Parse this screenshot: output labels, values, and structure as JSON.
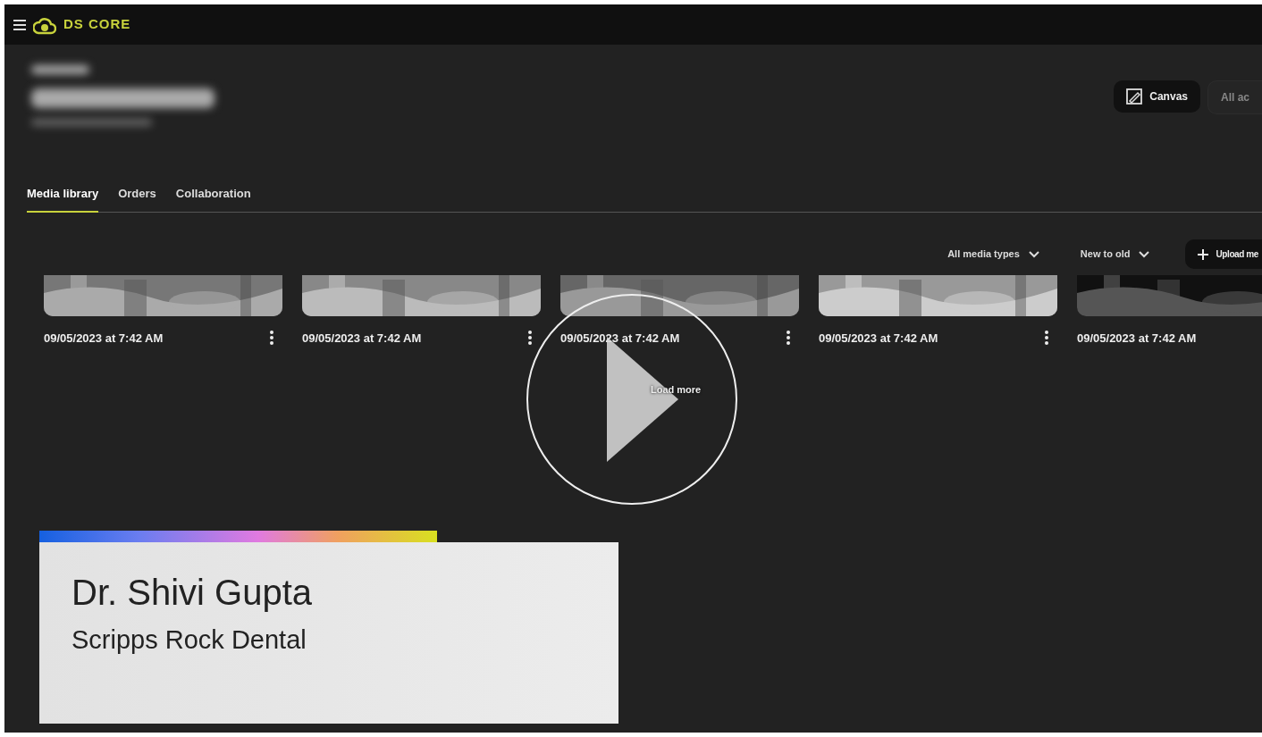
{
  "top_bar": {
    "brand": "DS CORE"
  },
  "header": {
    "buttons": [
      {
        "label": "Canvas",
        "kind": "canvas"
      },
      {
        "label": "All ac",
        "kind": "plain"
      }
    ]
  },
  "tabs": [
    {
      "label": "Media library",
      "selected": true
    },
    {
      "label": "Orders",
      "selected": false
    },
    {
      "label": "Collaboration",
      "selected": false
    }
  ],
  "toolbar": {
    "filters": [
      "All media types",
      "New to old"
    ],
    "upload": "Upload me"
  },
  "media": [
    {
      "date": "09/05/2023 at 7:42 AM"
    },
    {
      "date": "09/05/2023 at 7:42 AM"
    },
    {
      "date": "09/05/2023 at 7:42 AM"
    },
    {
      "date": "09/05/2023 at 7:42 AM"
    },
    {
      "date": "09/05/2023 at 7:42 AM"
    }
  ],
  "load_more": "Load more",
  "lower_third": {
    "name": "Dr. Shivi Gupta",
    "practice": "Scripps Rock Dental"
  }
}
